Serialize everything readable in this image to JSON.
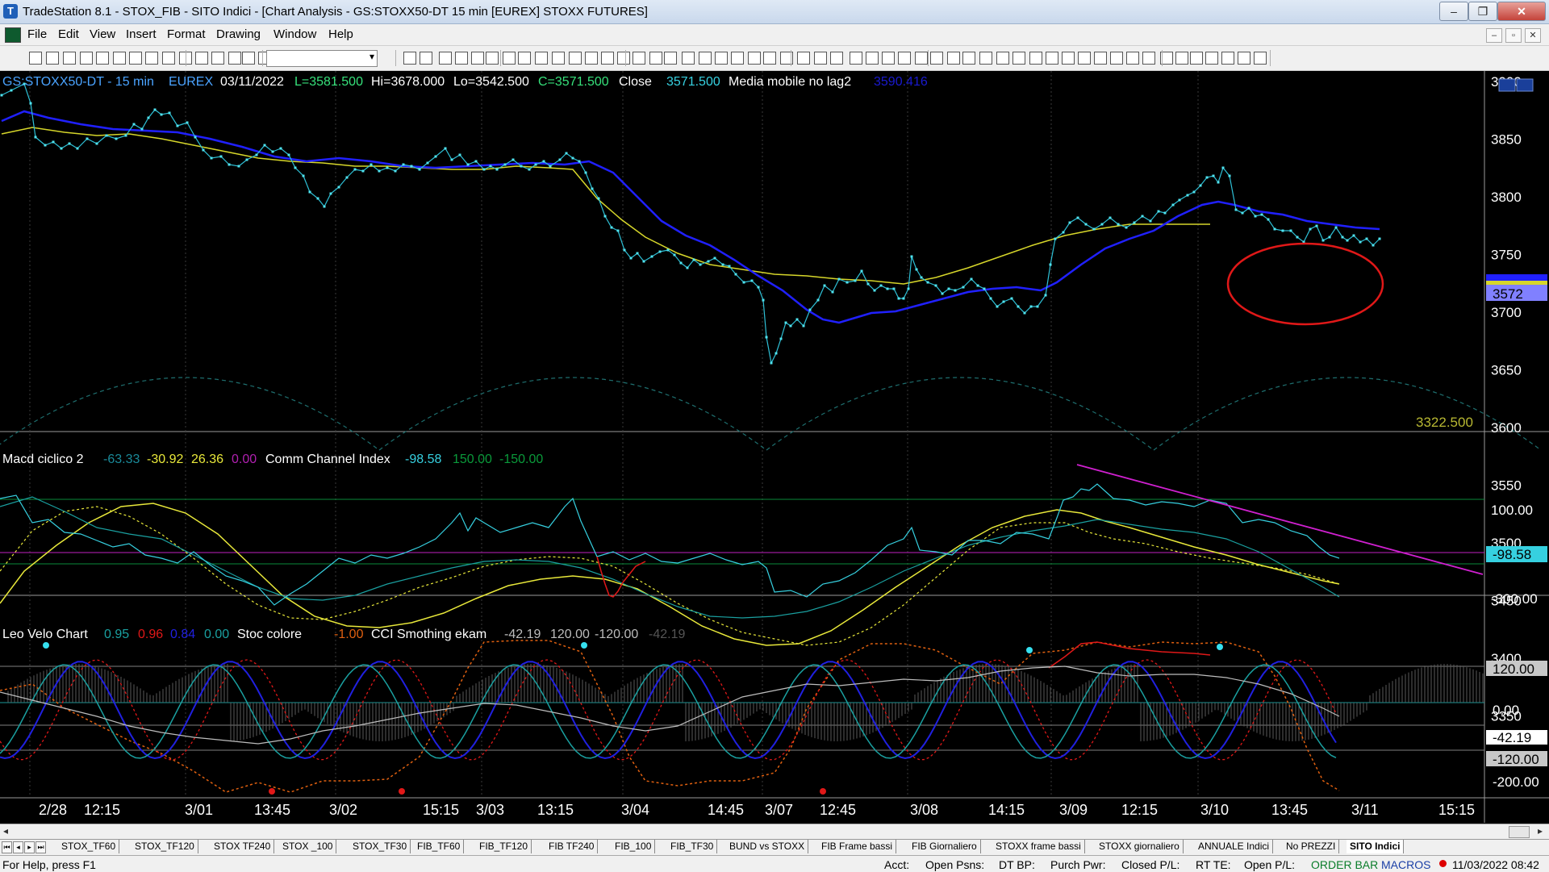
{
  "window": {
    "title": "TradeStation 8.1 - STOX_FIB - SITO Indici - [Chart Analysis - GS:STOXX50-DT  15 min  [EUREX] STOXX FUTURES]",
    "app_icon": "tradestation-icon",
    "controls": {
      "minimize": "‒",
      "maximize": "❐",
      "close": "✕"
    }
  },
  "menu": {
    "items": [
      "File",
      "Edit",
      "View",
      "Insert",
      "Format",
      "Drawing",
      "Window",
      "Help"
    ],
    "doc_controls": [
      "‒",
      "▫",
      "✕"
    ]
  },
  "chart": {
    "symbol": "GS:STOXX50-DT - 15 min",
    "exchange": "EUREX",
    "date": "03/11/2022",
    "last": "L=3581.500",
    "high": "Hi=3678.000",
    "low": "Lo=3542.500",
    "close_c": "C=3571.500",
    "close_label": "Close",
    "close_value": "3571.500",
    "ma_label": "Media mobile no lag2",
    "ma_value": "3590.416",
    "price_axis": [
      "3900",
      "3850",
      "3800",
      "3750",
      "3700",
      "3650",
      "3600",
      "3550",
      "3500",
      "3450",
      "3400",
      "3350"
    ],
    "price_marker": "3572",
    "low_marker": "3322.500",
    "colors": {
      "price": "#36d0e0",
      "ma_blue": "#2020ff",
      "ma_yellow": "#d6d62a",
      "ellipse": "#e01818",
      "trend": "#d020d0"
    }
  },
  "macd": {
    "label": "Macd ciclico 2",
    "v1": "-63.33",
    "v2": "-30.92",
    "v3": "26.36",
    "v4": "0.00",
    "cci_label": "Comm Channel Index",
    "cci_v1": "-98.58",
    "cci_v2": "150.00",
    "cci_v3": "-150.00",
    "axis": [
      "100.00",
      "-300.00"
    ],
    "marker": "-98.58"
  },
  "velo": {
    "label": "Leo Velo Chart",
    "v1": "0.95",
    "v2": "0.96",
    "v3": "0.84",
    "v4": "0.00",
    "stoc_label": "Stoc colore",
    "stoc_v": "-1.00",
    "cci_label": "CCI Smothing ekam",
    "cci_v1": "-42.19",
    "cci_v2": "120.00",
    "cci_v3": "-120.00",
    "cci_v4": "-42.19",
    "axis": [
      "120.00",
      "0.00",
      "-42.19",
      "-120.00",
      "-200.00"
    ]
  },
  "time_axis": [
    "2/28",
    "12:15",
    "3/01",
    "13:45",
    "3/02",
    "15:15",
    "3/03",
    "13:15",
    "3/04",
    "14:45",
    "3/07",
    "12:45",
    "3/08",
    "14:15",
    "3/09",
    "12:15",
    "3/10",
    "13:45",
    "3/11",
    "15:15"
  ],
  "tabs": [
    "STOX_TF60",
    "STOX_TF120",
    "STOX TF240",
    "STOX _100",
    "STOX_TF30",
    "FIB_TF60",
    "FIB_TF120",
    "FIB TF240",
    "FIB_100",
    "FIB_TF30",
    "BUND vs STOXX",
    "FIB Frame bassi",
    "FIB Giornaliero",
    "STOXX frame bassi",
    "STOXX giornaliero",
    "ANNUALE Indici",
    "No PREZZI",
    "SITO Indici"
  ],
  "status": {
    "help": "For Help, press F1",
    "acct": "Acct:",
    "open_psns": "Open Psns:",
    "dt_bp": "DT BP:",
    "purch_pwr": "Purch Pwr:",
    "closed_pl": "Closed P/L:",
    "rt_te": "RT TE:",
    "open_pl": "Open P/L:",
    "order_bar": "ORDER BAR",
    "macros": "MACROS",
    "datetime": "11/03/2022 08:42"
  }
}
